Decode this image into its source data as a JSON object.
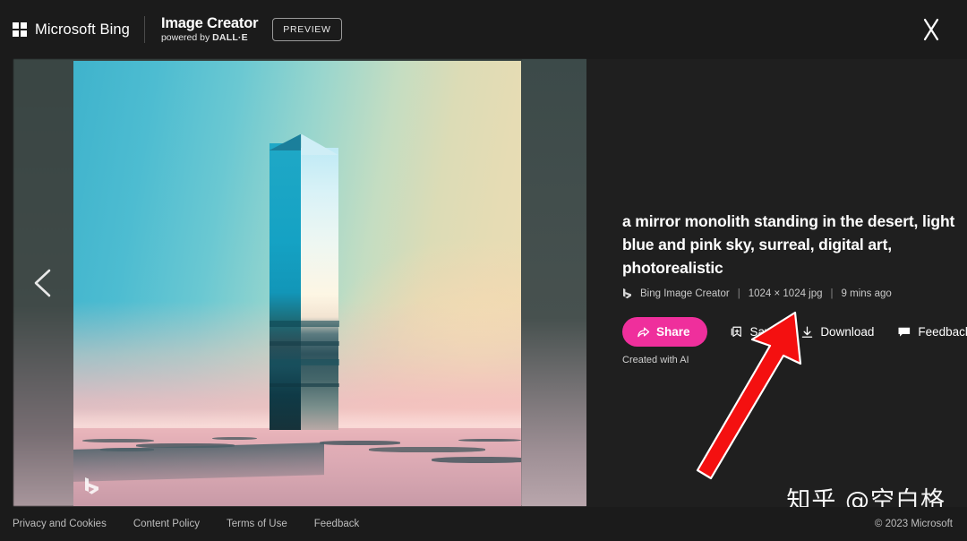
{
  "header": {
    "brand": "Microsoft Bing",
    "product_title": "Image Creator",
    "powered_prefix": "powered by ",
    "powered_by": "DALL·E",
    "preview_badge": "PREVIEW",
    "close_label": "Close"
  },
  "viewer": {
    "prev_label": "Previous image",
    "image_watermark": "bing-b-logo",
    "image_alt": "a mirror monolith standing in the desert at sunset"
  },
  "detail": {
    "prompt": "a mirror monolith standing in the desert, light blue and pink sky, surreal, digital art, photorealistic",
    "source": "Bing Image Creator",
    "dimensions": "1024 × 1024 jpg",
    "timestamp": "9 mins ago",
    "separator": "|",
    "created_with": "Created with AI"
  },
  "actions": {
    "share": "Share",
    "save": "Save",
    "download": "Download",
    "feedback": "Feedback"
  },
  "footer": {
    "links": [
      "Privacy and Cookies",
      "Content Policy",
      "Terms of Use",
      "Feedback"
    ],
    "copyright": "© 2023 Microsoft"
  },
  "watermark": {
    "text": "知乎 @空白格"
  },
  "colors": {
    "accent_pink": "#ef2f9c",
    "page_bg": "#1b1b1b",
    "panel_bg": "#1f1f1f",
    "annotation_red": "#f41010"
  }
}
